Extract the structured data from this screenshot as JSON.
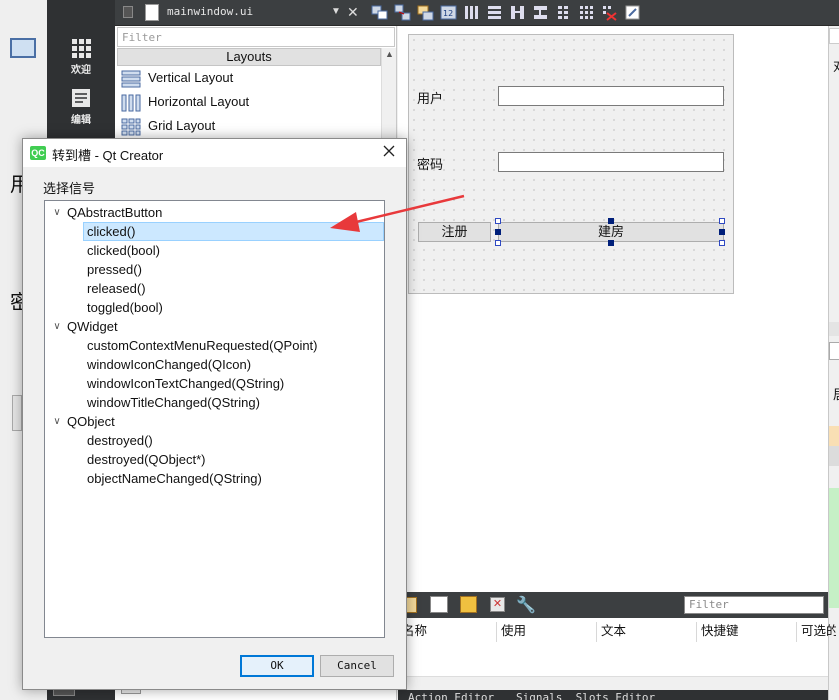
{
  "editor": {
    "file_tab": "mainwindow.ui",
    "close_symbol": "✕"
  },
  "mode_bar": {
    "items": [
      {
        "label": "欢迎",
        "icon": "grid-icon"
      },
      {
        "label": "编辑",
        "icon": "document-icon"
      }
    ]
  },
  "widget_box": {
    "filter_placeholder": "Filter",
    "category": "Layouts",
    "items": [
      {
        "label": "Vertical Layout",
        "icon": "vertical-layout-icon"
      },
      {
        "label": "Horizontal Layout",
        "icon": "horizontal-layout-icon"
      },
      {
        "label": "Grid Layout",
        "icon": "grid-layout-icon"
      }
    ]
  },
  "form": {
    "user_label": "用户",
    "password_label": "密码",
    "register_button": "注册",
    "build_button": "建房"
  },
  "left_fragments": {
    "char1": "用",
    "char2": "密"
  },
  "dialog": {
    "title": "转到槽 - Qt Creator",
    "logo_text": "QC",
    "group_label": "选择信号",
    "tree": [
      {
        "group": "QAbstractButton",
        "signals": [
          "clicked()",
          "clicked(bool)",
          "pressed()",
          "released()",
          "toggled(bool)"
        ]
      },
      {
        "group": "QWidget",
        "signals": [
          "customContextMenuRequested(QPoint)",
          "windowIconChanged(QIcon)",
          "windowIconTextChanged(QString)",
          "windowTitleChanged(QString)"
        ]
      },
      {
        "group": "QObject",
        "signals": [
          "destroyed()",
          "destroyed(QObject*)",
          "objectNameChanged(QString)"
        ]
      }
    ],
    "selected_signal": "clicked()",
    "ok_label": "OK",
    "cancel_label": "Cancel"
  },
  "action_editor": {
    "filter_placeholder": "Filter",
    "columns": [
      "名称",
      "使用",
      "文本",
      "快捷键",
      "可选的"
    ],
    "bottom_tab_1": "Action Editor",
    "bottom_tab_2": "Signals _Slots Editor"
  },
  "right_panel": {
    "frag1": "对",
    "frag2": "居"
  },
  "colors": {
    "selection": "#cce8ff",
    "accent_blue": "#0078d7",
    "arrow_red": "#e8393b",
    "dark_toolbar": "#3c3f41",
    "mode_bar": "#2f3133"
  }
}
